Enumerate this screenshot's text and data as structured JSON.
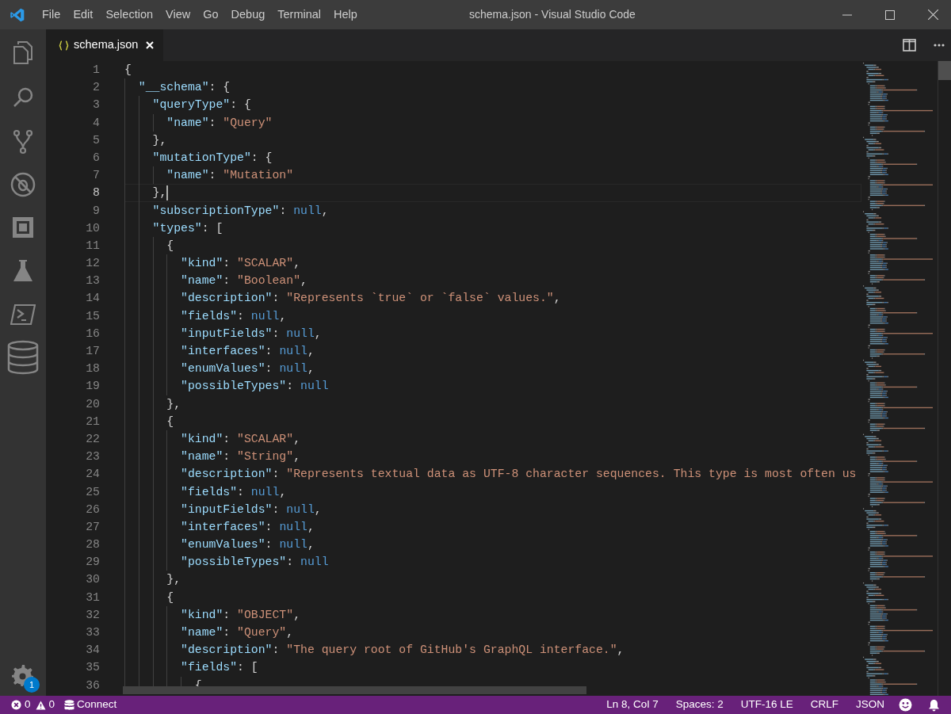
{
  "window": {
    "title": "schema.json - Visual Studio Code"
  },
  "menu": [
    "File",
    "Edit",
    "Selection",
    "View",
    "Go",
    "Debug",
    "Terminal",
    "Help"
  ],
  "activity_bar": {
    "settings_badge": "1"
  },
  "tabs": [
    {
      "label": "schema.json",
      "selected": true
    }
  ],
  "editor": {
    "lines": [
      {
        "number": "1",
        "selected": false,
        "tokens": [
          {
            "kind": "punct",
            "text": "{"
          }
        ]
      },
      {
        "number": "2",
        "selected": false,
        "tokens": [
          {
            "kind": "key",
            "text": "\"__schema\""
          },
          {
            "kind": "punct",
            "text": ": {"
          }
        ]
      },
      {
        "number": "3",
        "selected": false,
        "tokens": [
          {
            "kind": "key",
            "text": "\"queryType\""
          },
          {
            "kind": "punct",
            "text": ": {"
          }
        ]
      },
      {
        "number": "4",
        "selected": false,
        "tokens": [
          {
            "kind": "key",
            "text": "\"name\""
          },
          {
            "kind": "punct",
            "text": ": "
          },
          {
            "kind": "string",
            "text": "\"Query\""
          }
        ]
      },
      {
        "number": "5",
        "selected": false,
        "tokens": [
          {
            "kind": "punct",
            "text": "},"
          }
        ]
      },
      {
        "number": "6",
        "selected": false,
        "tokens": [
          {
            "kind": "key",
            "text": "\"mutationType\""
          },
          {
            "kind": "punct",
            "text": ": {"
          }
        ]
      },
      {
        "number": "7",
        "selected": false,
        "tokens": [
          {
            "kind": "key",
            "text": "\"name\""
          },
          {
            "kind": "punct",
            "text": ": "
          },
          {
            "kind": "string",
            "text": "\"Mutation\""
          }
        ]
      },
      {
        "number": "8",
        "selected": true,
        "tokens": [
          {
            "kind": "punct",
            "text": "},"
          }
        ]
      },
      {
        "number": "9",
        "selected": false,
        "tokens": [
          {
            "kind": "key",
            "text": "\"subscriptionType\""
          },
          {
            "kind": "punct",
            "text": ": "
          },
          {
            "kind": "keyword",
            "text": "null"
          },
          {
            "kind": "punct",
            "text": ","
          }
        ]
      },
      {
        "number": "10",
        "selected": false,
        "tokens": [
          {
            "kind": "key",
            "text": "\"types\""
          },
          {
            "kind": "punct",
            "text": ": ["
          }
        ]
      },
      {
        "number": "11",
        "selected": false,
        "tokens": [
          {
            "kind": "punct",
            "text": "{"
          }
        ]
      },
      {
        "number": "12",
        "selected": false,
        "tokens": [
          {
            "kind": "key",
            "text": "\"kind\""
          },
          {
            "kind": "punct",
            "text": ": "
          },
          {
            "kind": "string",
            "text": "\"SCALAR\""
          },
          {
            "kind": "punct",
            "text": ","
          }
        ]
      },
      {
        "number": "13",
        "selected": false,
        "tokens": [
          {
            "kind": "key",
            "text": "\"name\""
          },
          {
            "kind": "punct",
            "text": ": "
          },
          {
            "kind": "string",
            "text": "\"Boolean\""
          },
          {
            "kind": "punct",
            "text": ","
          }
        ]
      },
      {
        "number": "14",
        "selected": false,
        "tokens": [
          {
            "kind": "key",
            "text": "\"description\""
          },
          {
            "kind": "punct",
            "text": ": "
          },
          {
            "kind": "string",
            "text": "\"Represents `true` or `false` values.\""
          },
          {
            "kind": "punct",
            "text": ","
          }
        ]
      },
      {
        "number": "15",
        "selected": false,
        "tokens": [
          {
            "kind": "key",
            "text": "\"fields\""
          },
          {
            "kind": "punct",
            "text": ": "
          },
          {
            "kind": "keyword",
            "text": "null"
          },
          {
            "kind": "punct",
            "text": ","
          }
        ]
      },
      {
        "number": "16",
        "selected": false,
        "tokens": [
          {
            "kind": "key",
            "text": "\"inputFields\""
          },
          {
            "kind": "punct",
            "text": ": "
          },
          {
            "kind": "keyword",
            "text": "null"
          },
          {
            "kind": "punct",
            "text": ","
          }
        ]
      },
      {
        "number": "17",
        "selected": false,
        "tokens": [
          {
            "kind": "key",
            "text": "\"interfaces\""
          },
          {
            "kind": "punct",
            "text": ": "
          },
          {
            "kind": "keyword",
            "text": "null"
          },
          {
            "kind": "punct",
            "text": ","
          }
        ]
      },
      {
        "number": "18",
        "selected": false,
        "tokens": [
          {
            "kind": "key",
            "text": "\"enumValues\""
          },
          {
            "kind": "punct",
            "text": ": "
          },
          {
            "kind": "keyword",
            "text": "null"
          },
          {
            "kind": "punct",
            "text": ","
          }
        ]
      },
      {
        "number": "19",
        "selected": false,
        "tokens": [
          {
            "kind": "key",
            "text": "\"possibleTypes\""
          },
          {
            "kind": "punct",
            "text": ": "
          },
          {
            "kind": "keyword",
            "text": "null"
          }
        ]
      },
      {
        "number": "20",
        "selected": false,
        "tokens": [
          {
            "kind": "punct",
            "text": "},"
          }
        ]
      },
      {
        "number": "21",
        "selected": false,
        "tokens": [
          {
            "kind": "punct",
            "text": "{"
          }
        ]
      },
      {
        "number": "22",
        "selected": false,
        "tokens": [
          {
            "kind": "key",
            "text": "\"kind\""
          },
          {
            "kind": "punct",
            "text": ": "
          },
          {
            "kind": "string",
            "text": "\"SCALAR\""
          },
          {
            "kind": "punct",
            "text": ","
          }
        ]
      },
      {
        "number": "23",
        "selected": false,
        "tokens": [
          {
            "kind": "key",
            "text": "\"name\""
          },
          {
            "kind": "punct",
            "text": ": "
          },
          {
            "kind": "string",
            "text": "\"String\""
          },
          {
            "kind": "punct",
            "text": ","
          }
        ]
      },
      {
        "number": "24",
        "selected": false,
        "tokens": [
          {
            "kind": "key",
            "text": "\"description\""
          },
          {
            "kind": "punct",
            "text": ": "
          },
          {
            "kind": "string",
            "text": "\"Represents textual data as UTF-8 character sequences. This type is most often us"
          }
        ]
      },
      {
        "number": "25",
        "selected": false,
        "tokens": [
          {
            "kind": "key",
            "text": "\"fields\""
          },
          {
            "kind": "punct",
            "text": ": "
          },
          {
            "kind": "keyword",
            "text": "null"
          },
          {
            "kind": "punct",
            "text": ","
          }
        ]
      },
      {
        "number": "26",
        "selected": false,
        "tokens": [
          {
            "kind": "key",
            "text": "\"inputFields\""
          },
          {
            "kind": "punct",
            "text": ": "
          },
          {
            "kind": "keyword",
            "text": "null"
          },
          {
            "kind": "punct",
            "text": ","
          }
        ]
      },
      {
        "number": "27",
        "selected": false,
        "tokens": [
          {
            "kind": "key",
            "text": "\"interfaces\""
          },
          {
            "kind": "punct",
            "text": ": "
          },
          {
            "kind": "keyword",
            "text": "null"
          },
          {
            "kind": "punct",
            "text": ","
          }
        ]
      },
      {
        "number": "28",
        "selected": false,
        "tokens": [
          {
            "kind": "key",
            "text": "\"enumValues\""
          },
          {
            "kind": "punct",
            "text": ": "
          },
          {
            "kind": "keyword",
            "text": "null"
          },
          {
            "kind": "punct",
            "text": ","
          }
        ]
      },
      {
        "number": "29",
        "selected": false,
        "tokens": [
          {
            "kind": "key",
            "text": "\"possibleTypes\""
          },
          {
            "kind": "punct",
            "text": ": "
          },
          {
            "kind": "keyword",
            "text": "null"
          }
        ]
      },
      {
        "number": "30",
        "selected": false,
        "tokens": [
          {
            "kind": "punct",
            "text": "},"
          }
        ]
      },
      {
        "number": "31",
        "selected": false,
        "tokens": [
          {
            "kind": "punct",
            "text": "{"
          }
        ]
      },
      {
        "number": "32",
        "selected": false,
        "tokens": [
          {
            "kind": "key",
            "text": "\"kind\""
          },
          {
            "kind": "punct",
            "text": ": "
          },
          {
            "kind": "string",
            "text": "\"OBJECT\""
          },
          {
            "kind": "punct",
            "text": ","
          }
        ]
      },
      {
        "number": "33",
        "selected": false,
        "tokens": [
          {
            "kind": "key",
            "text": "\"name\""
          },
          {
            "kind": "punct",
            "text": ": "
          },
          {
            "kind": "string",
            "text": "\"Query\""
          },
          {
            "kind": "punct",
            "text": ","
          }
        ]
      },
      {
        "number": "34",
        "selected": false,
        "tokens": [
          {
            "kind": "key",
            "text": "\"description\""
          },
          {
            "kind": "punct",
            "text": ": "
          },
          {
            "kind": "string",
            "text": "\"The query root of GitHub's GraphQL interface.\""
          },
          {
            "kind": "punct",
            "text": ","
          }
        ]
      },
      {
        "number": "35",
        "selected": false,
        "tokens": [
          {
            "kind": "key",
            "text": "\"fields\""
          },
          {
            "kind": "punct",
            "text": ": ["
          }
        ]
      },
      {
        "number": "36",
        "selected": false,
        "tokens": [
          {
            "kind": "punct",
            "text": "{"
          }
        ]
      }
    ]
  },
  "status_bar": {
    "errors": "0",
    "warnings": "0",
    "connect": "Connect",
    "position": "Ln 8, Col 7",
    "spaces": "Spaces: 2",
    "encoding": "UTF-16 LE",
    "eol": "CRLF",
    "language": "JSON"
  }
}
